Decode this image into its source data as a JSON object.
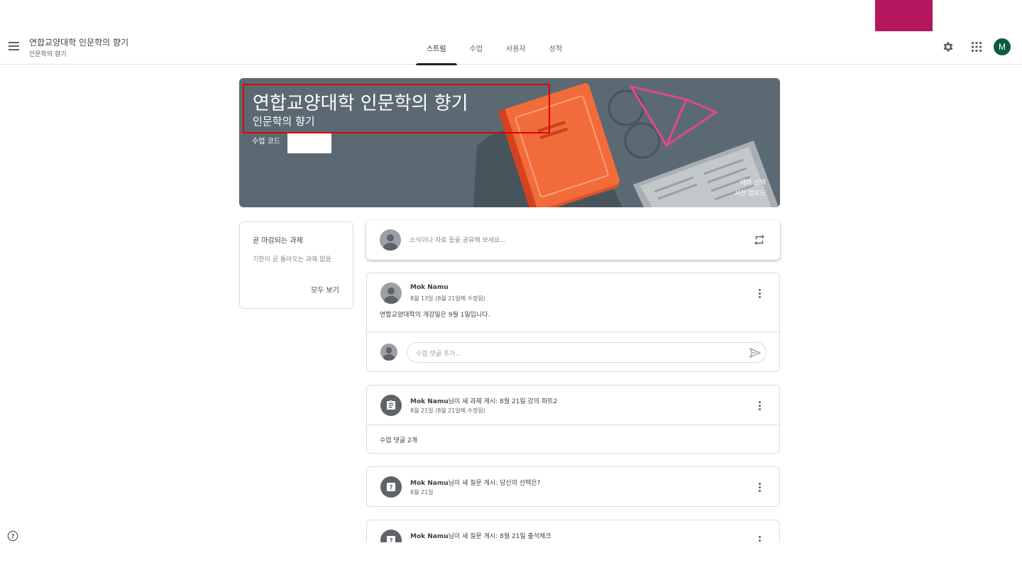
{
  "header": {
    "title": "연합교양대학 인문학의 향기",
    "subtitle": "인문학의 향기",
    "tabs": [
      {
        "label": "스트림",
        "active": true
      },
      {
        "label": "수업",
        "active": false
      },
      {
        "label": "사용자",
        "active": false
      },
      {
        "label": "성적",
        "active": false
      }
    ],
    "avatar_letter": "M",
    "icons": [
      "menu-icon",
      "gear-icon",
      "apps-grid-icon",
      "help-icon"
    ]
  },
  "banner": {
    "title": "연합교양대학 인문학의 향기",
    "subtitle": "인문학의 향기",
    "code_label": "수업 코드",
    "select_theme": "테마 선택",
    "upload_photo": "사진 업로드",
    "colors": {
      "background": "#5b6972",
      "book": "#f26b3a",
      "glasses": "#e0488f",
      "highlight": "#e20000"
    }
  },
  "upcoming": {
    "title": "곧 마감되는 과제",
    "empty_text": "기한이 곧 돌아오는 과제 없음",
    "view_all": "모두 보기"
  },
  "share": {
    "placeholder": "소식이나 자료 등을 공유해 보세요..."
  },
  "posts": [
    {
      "author": "Mok Namu",
      "date": "8월 13일 (8월 21일에 수정됨)",
      "body": "연합교양대학의 개강일은 9월 1일입니다.",
      "comment_placeholder": "수업 댓글 추가..."
    },
    {
      "author": "Mok Namu",
      "action": "님이 새 과제 게시: 8월 21일 강의 파트2",
      "date": "8월 21일 (8월 21일에 수정됨)",
      "comments": "수업 댓글 2개"
    },
    {
      "author": "Mok Namu",
      "action": "님이 새 질문 게시: 당신의 선택은?",
      "date": "8월 21일"
    },
    {
      "author": "Mok Namu",
      "action": "님이 새 질문 게시: 8월 21일 출석체크"
    }
  ]
}
